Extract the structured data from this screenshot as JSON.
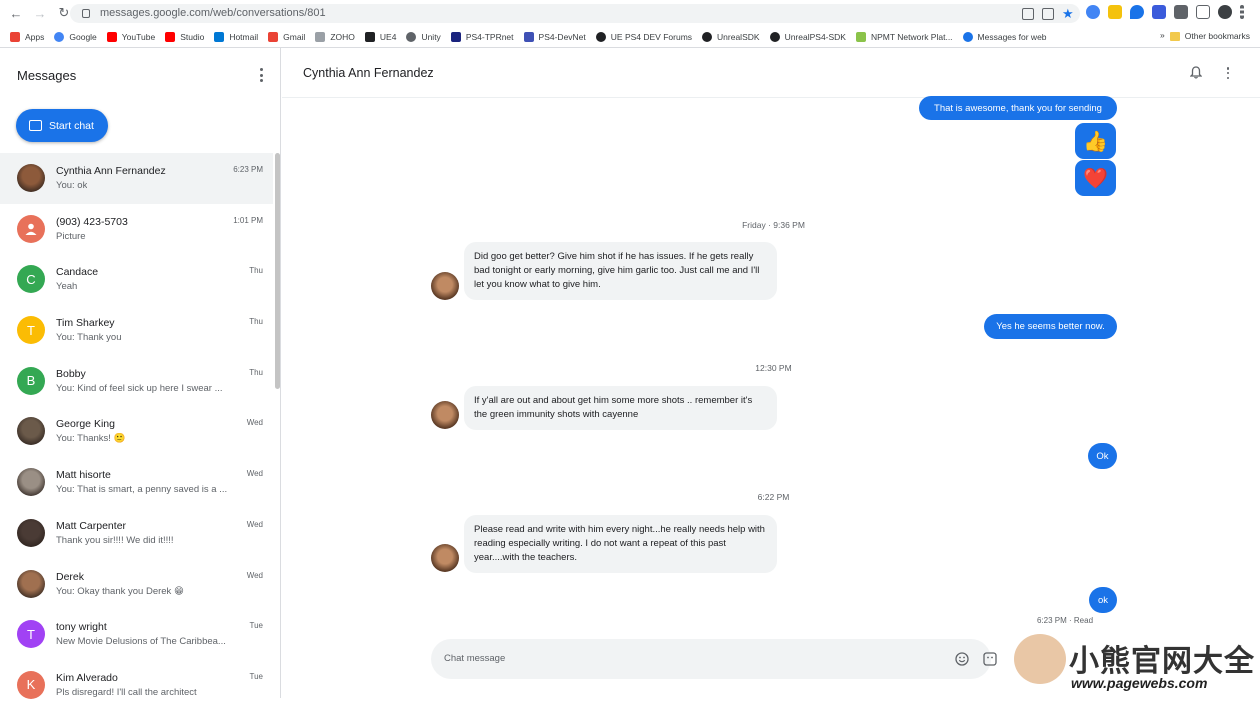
{
  "browser": {
    "url": "messages.google.com/web/conversations/801",
    "bookmarks": [
      "Apps",
      "Google",
      "YouTube",
      "Studio",
      "Hotmail",
      "Gmail",
      "ZOHO",
      "UE4",
      "Unity",
      "PS4-TPRnet",
      "PS4-DevNet",
      "UE PS4 DEV Forums",
      "UnrealSDK",
      "UnrealPS4-SDK",
      "NPMT Network Plat...",
      "Messages for web"
    ],
    "bookmark_more": "»",
    "other_bookmarks": "Other bookmarks"
  },
  "sidebar": {
    "title": "Messages",
    "start_chat_label": "Start chat",
    "conversations": [
      {
        "name": "Cynthia Ann Fernandez",
        "preview": "You: ok",
        "time": "6:23 PM",
        "avatar": "photo",
        "color": "#8d5a3b"
      },
      {
        "name": "(903) 423-5703",
        "preview": "Picture",
        "time": "1:01 PM",
        "avatar": "person-icon",
        "color": "#e8715a"
      },
      {
        "name": "Candace",
        "preview": "Yeah",
        "time": "Thu",
        "avatar": "C",
        "color": "#34a853"
      },
      {
        "name": "Tim Sharkey",
        "preview": "You: Thank you",
        "time": "Thu",
        "avatar": "T",
        "color": "#fbbc04"
      },
      {
        "name": "Bobby",
        "preview": "You: Kind of feel sick up here I swear ...",
        "time": "Thu",
        "avatar": "B",
        "color": "#34a853"
      },
      {
        "name": "George King",
        "preview": "You: Thanks! 🙂",
        "time": "Wed",
        "avatar": "photo",
        "color": "#6b5a4a"
      },
      {
        "name": "Matt hisorte",
        "preview": "You: That is smart, a penny saved is a ...",
        "time": "Wed",
        "avatar": "photo",
        "color": "#9a8f85"
      },
      {
        "name": "Matt Carpenter",
        "preview": "Thank you sir!!!! We did it!!!!",
        "time": "Wed",
        "avatar": "photo",
        "color": "#4a3b35"
      },
      {
        "name": "Derek",
        "preview": "You: Okay thank you Derek 😁",
        "time": "Wed",
        "avatar": "photo",
        "color": "#a07050"
      },
      {
        "name": "tony wright",
        "preview": "New Movie Delusions of The Caribbea...",
        "time": "Tue",
        "avatar": "T",
        "color": "#a142f4"
      },
      {
        "name": "Kim Alverado",
        "preview": "Pls disregard! I'll call the architect",
        "time": "Tue",
        "avatar": "K",
        "color": "#e8715a"
      }
    ]
  },
  "conversation": {
    "contact_name": "Cynthia Ann Fernandez",
    "messages": [
      {
        "dir": "out",
        "text": "That is awesome, thank you for sending"
      },
      {
        "dir": "out",
        "emoji": "👍"
      },
      {
        "dir": "out",
        "emoji": "❤️"
      },
      {
        "dir": "stamp",
        "text": "Friday · 9:36 PM"
      },
      {
        "dir": "in",
        "text": "Did goo get better? Give him shot if he has issues. If he gets really bad tonight or early morning, give him garlic too. Just call me and I'll let you know what to give him."
      },
      {
        "dir": "out",
        "text": "Yes he seems better now."
      },
      {
        "dir": "stamp",
        "text": "12:30 PM"
      },
      {
        "dir": "in",
        "text": "If y'all are out and about get him some more shots .. remember it's the green immunity shots with cayenne"
      },
      {
        "dir": "out",
        "text": "Ok"
      },
      {
        "dir": "stamp",
        "text": "6:22 PM"
      },
      {
        "dir": "in",
        "text": "Please read and write with him every night...he really needs help with reading especially writing. I do not want a repeat of this past year....with the teachers."
      },
      {
        "dir": "out",
        "text": "ok"
      }
    ],
    "status_time": "6:23 PM",
    "status_read": "Read"
  },
  "composer": {
    "placeholder": "Chat message"
  },
  "watermark": {
    "text": "小熊官网大全",
    "url": "www.pagewebs.com"
  },
  "colors": {
    "accent": "#1a73e8"
  }
}
